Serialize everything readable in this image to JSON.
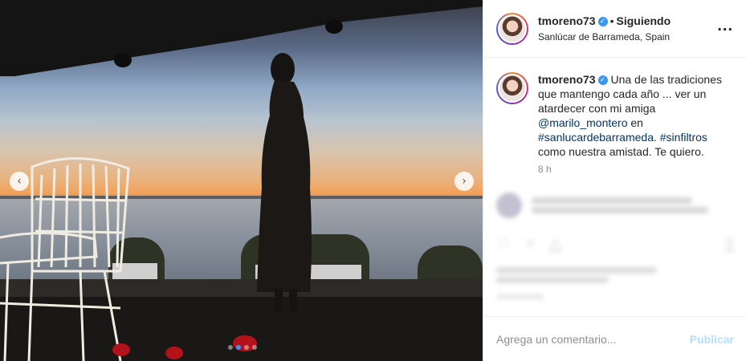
{
  "post": {
    "carousel": {
      "prev_icon": "chevron-left-icon",
      "next_icon": "chevron-right-icon",
      "total_slides": 4,
      "active_slide": 2
    }
  },
  "header": {
    "username": "tmoreno73",
    "verified_icon": "verified-badge-icon",
    "separator": "•",
    "follow_status": "Siguiendo",
    "location": "Sanlúcar de Barrameda, Spain",
    "more_icon": "more-options-icon",
    "more_label": "..."
  },
  "caption": {
    "username": "tmoreno73",
    "text_1": "Una de las tradiciones que mantengo cada año ... ver un atardecer con mi amiga ",
    "mention": "@marilo_montero",
    "text_2": " en ",
    "hashtag_1": "#sanlucardebarrameda",
    "text_3": ". ",
    "hashtag_2": "#sinfiltros",
    "text_4": " como nuestra amistad. Te quiero.",
    "time": "8 h"
  },
  "composer": {
    "placeholder": "Agrega un comentario...",
    "publish_label": "Publicar"
  },
  "colors": {
    "accent": "#3897f0",
    "link": "#003569",
    "muted": "#8e8e8e",
    "publish_disabled": "#b2dffc"
  }
}
